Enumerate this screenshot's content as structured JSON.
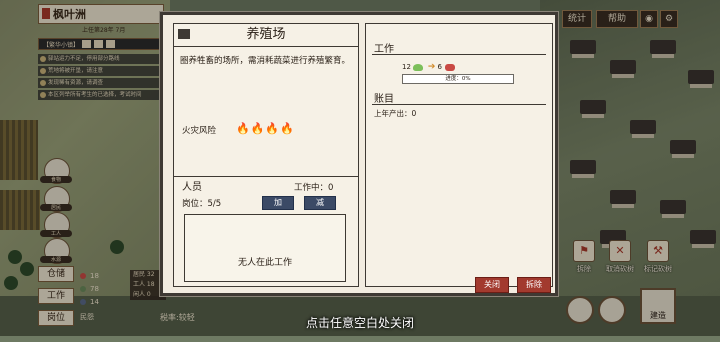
{
  "town": {
    "name": "枫叶洲",
    "date": "上任第28年 7月"
  },
  "speed_bar": {
    "label": "【繁华小镇】"
  },
  "notices": [
    "驿站运力不足，停用部分路线",
    "荒地将被开垦，请注意",
    "发现稀有资源，请调查",
    "本区列举所有考生的已选择，考试时间"
  ],
  "side_icons": [
    {
      "label": "食物"
    },
    {
      "label": "居民"
    },
    {
      "label": "工人"
    },
    {
      "label": "水源"
    }
  ],
  "left_buttons": {
    "warehouse": "仓储",
    "work": "工作",
    "post": "岗位"
  },
  "stats": [
    {
      "value": "18",
      "color": "#c94a44"
    },
    {
      "value": "78",
      "color": "#6a8a5a"
    },
    {
      "value": "14",
      "color": "#5a6a8a"
    }
  ],
  "people_box": [
    "居民 32",
    "工人 18",
    "闲人 0"
  ],
  "tax": "税率:较轻",
  "residents_label": "民怨",
  "top_buttons": {
    "stats": "统计",
    "help": "帮助"
  },
  "map_actions": [
    {
      "label": "拆除"
    },
    {
      "label": "取消砍树"
    },
    {
      "label": "标记砍树"
    }
  ],
  "build_label": "建造",
  "dialog": {
    "title": "养殖场",
    "description": "圈养牲畜的场所，需消耗蔬菜进行养殖繁育。",
    "fire_risk_label": "火灾风险",
    "fire_icons": "🔥🔥🔥🔥",
    "staff": {
      "title": "人员",
      "working": "工作中：0",
      "posts": "岗位：5/5",
      "add": "加",
      "reduce": "减",
      "empty": "无人在此工作"
    },
    "work": {
      "title": "工作",
      "input_qty": "12",
      "output_qty": "6",
      "progress_label": "进度：0%",
      "progress": 0
    },
    "ledger": {
      "title": "账目",
      "last_year": "上年产出：0"
    },
    "close": "关闭",
    "demolish": "拆除"
  },
  "hint": "点击任意空白处关闭"
}
